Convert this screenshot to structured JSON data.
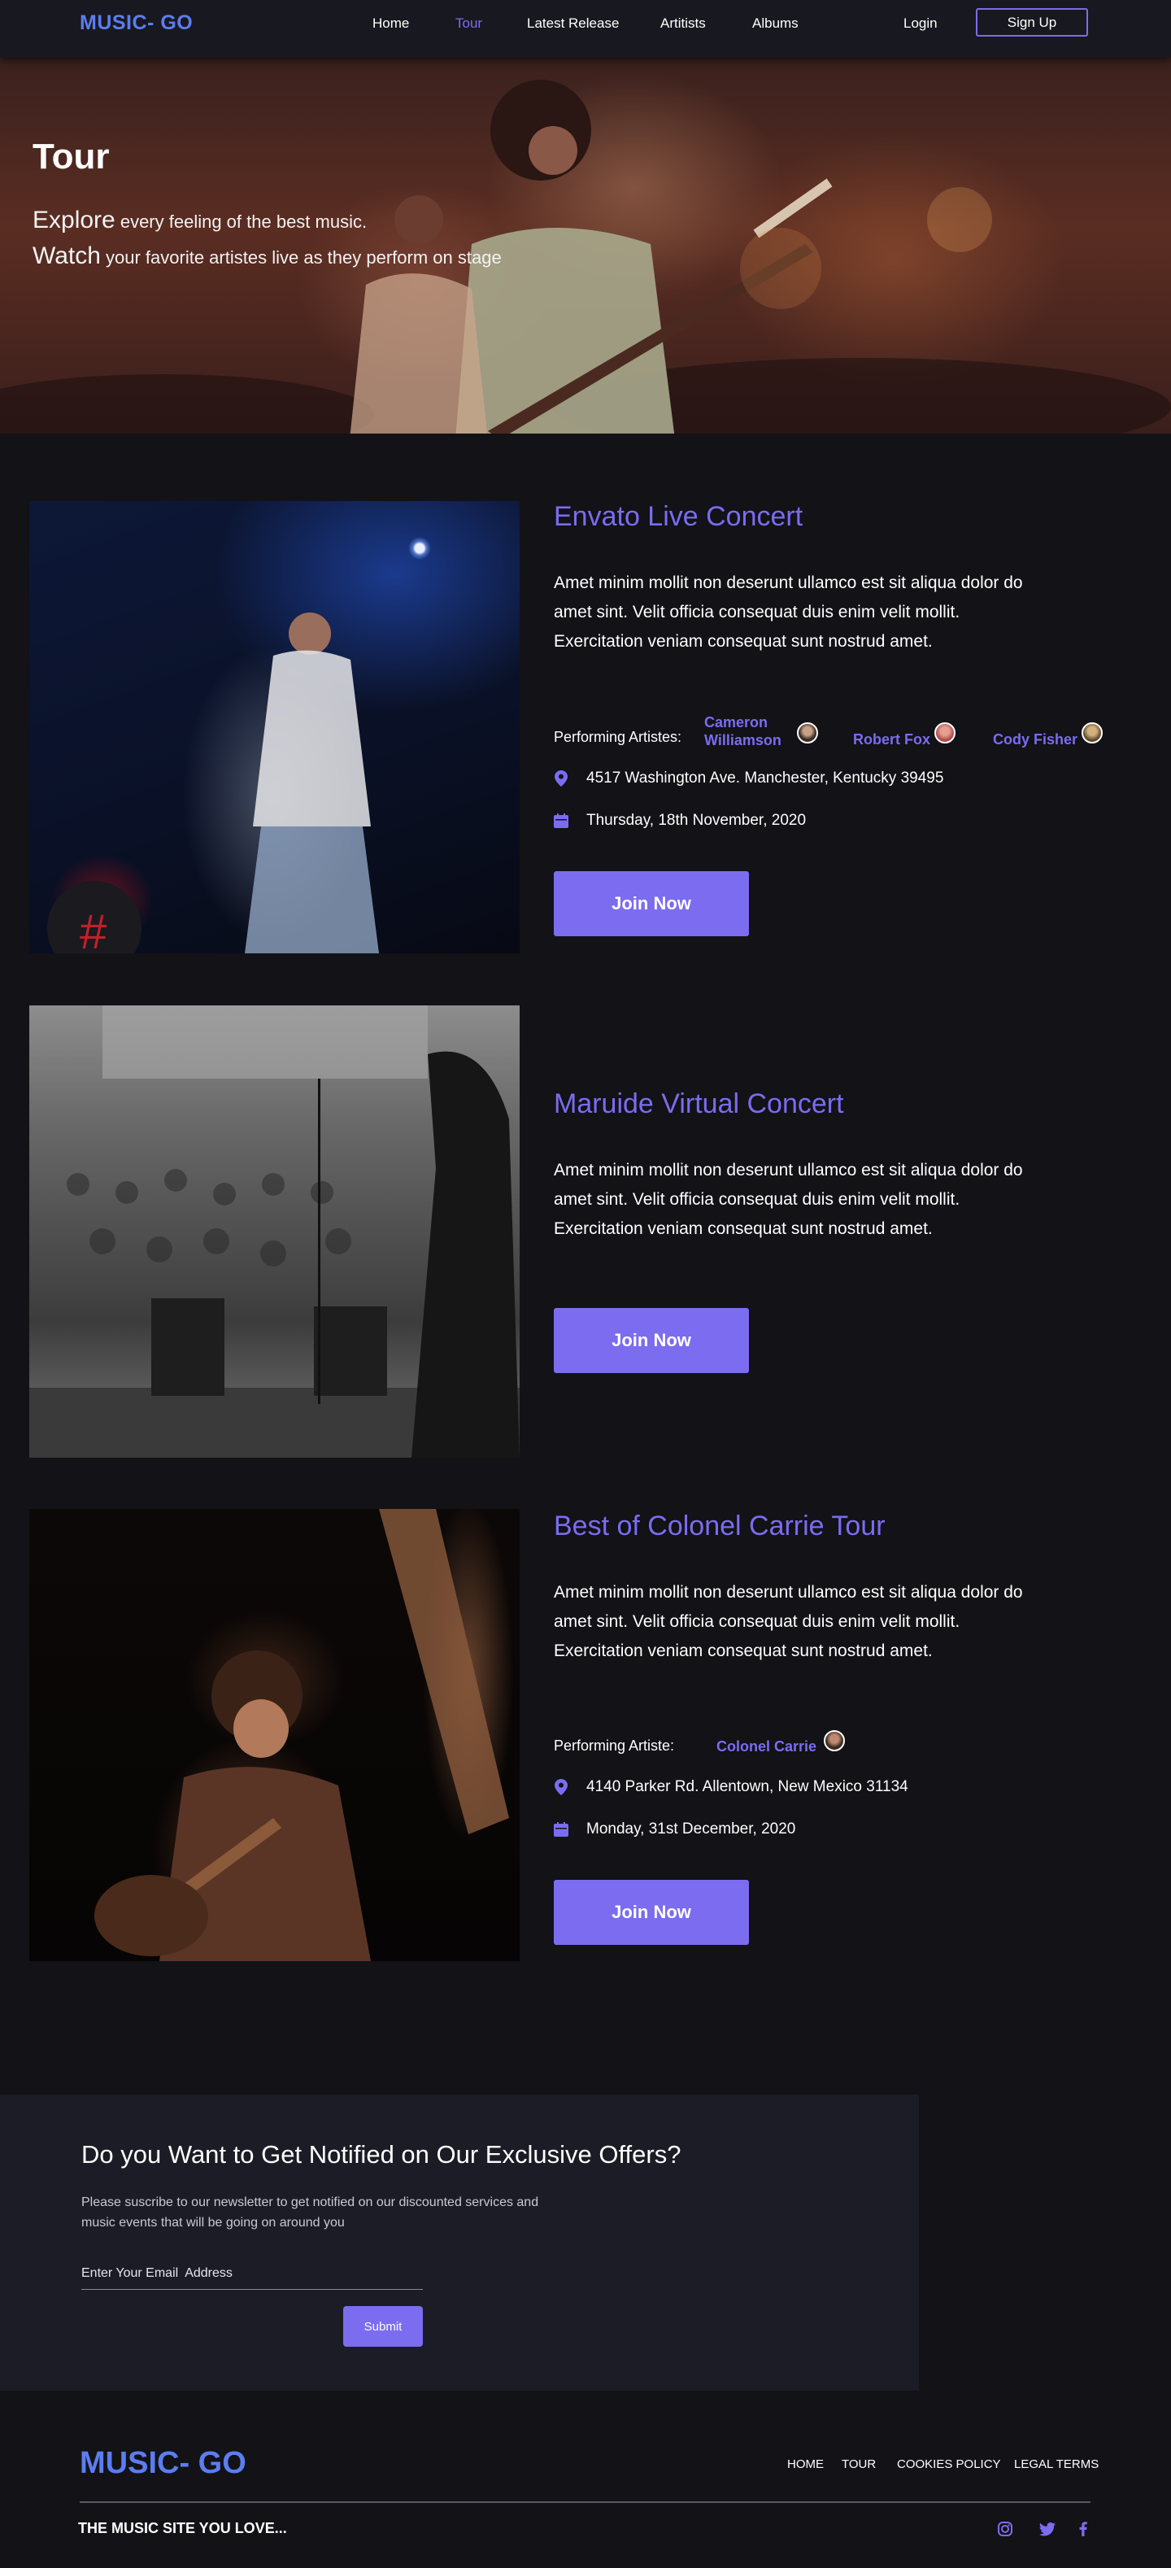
{
  "nav": {
    "logo": "MUSIC- GO",
    "links": [
      "Home",
      "Tour",
      "Latest Release",
      "Artitists",
      "Albums"
    ],
    "active": "Tour",
    "login": "Login",
    "signup": "Sign Up"
  },
  "hero": {
    "title": "Tour",
    "line1_big": "Explore",
    "line1_rest": " every feeling of the best music.",
    "line2_big": "Watch",
    "line2_rest": " your favorite artistes live as they perform on stage"
  },
  "concerts": [
    {
      "title": "Envato Live Concert",
      "description": "Amet minim mollit non deserunt ullamco est sit aliqua dolor do amet sint. Velit officia consequat duis enim velit mollit. Exercitation veniam consequat sunt nostrud amet.",
      "performing_label": "Performing Artistes:",
      "artists": [
        {
          "name_line1": "Cameron",
          "name_line2": "Williamson"
        },
        {
          "name": "Robert Fox"
        },
        {
          "name": "Cody Fisher"
        }
      ],
      "address": "4517 Washington Ave. Manchester, Kentucky 39495",
      "date": "Thursday,  18th November, 2020",
      "button": "Join Now"
    },
    {
      "title": "Maruide Virtual Concert",
      "description": "Amet minim mollit non deserunt ullamco est sit aliqua dolor do amet sint. Velit officia consequat duis enim velit mollit. Exercitation veniam consequat sunt nostrud amet.",
      "button": "Join Now"
    },
    {
      "title": "Best of Colonel Carrie Tour",
      "description": "Amet minim mollit non deserunt ullamco est sit aliqua dolor do amet sint. Velit officia consequat duis enim velit mollit. Exercitation veniam consequat sunt nostrud amet.",
      "performing_label": "Performing Artiste:",
      "artists": [
        {
          "name": "Colonel Carrie"
        }
      ],
      "address": "4140 Parker Rd. Allentown, New Mexico 31134",
      "date": "Monday,  31st December, 2020",
      "button": "Join Now"
    }
  ],
  "newsletter": {
    "title": "Do you Want to Get Notified on Our Exclusive Offers?",
    "description": "Please suscribe to our newsletter to get  notified on our  discounted services and music events that will be going on around you",
    "placeholder": "Enter Your Email  Address",
    "submit": "Submit"
  },
  "footer": {
    "logo": "MUSIC- GO",
    "links": [
      "HOME",
      "TOUR",
      "COOKIES POLICY",
      "LEGAL TERMS"
    ],
    "tagline": "THE MUSIC SITE YOU LOVE...",
    "social_icons": [
      "instagram-icon",
      "twitter-icon",
      "facebook-icon"
    ]
  },
  "colors": {
    "accent": "#7b6cf0",
    "logo": "#5b7df0",
    "background": "#121217",
    "panel": "#1b1c25"
  }
}
